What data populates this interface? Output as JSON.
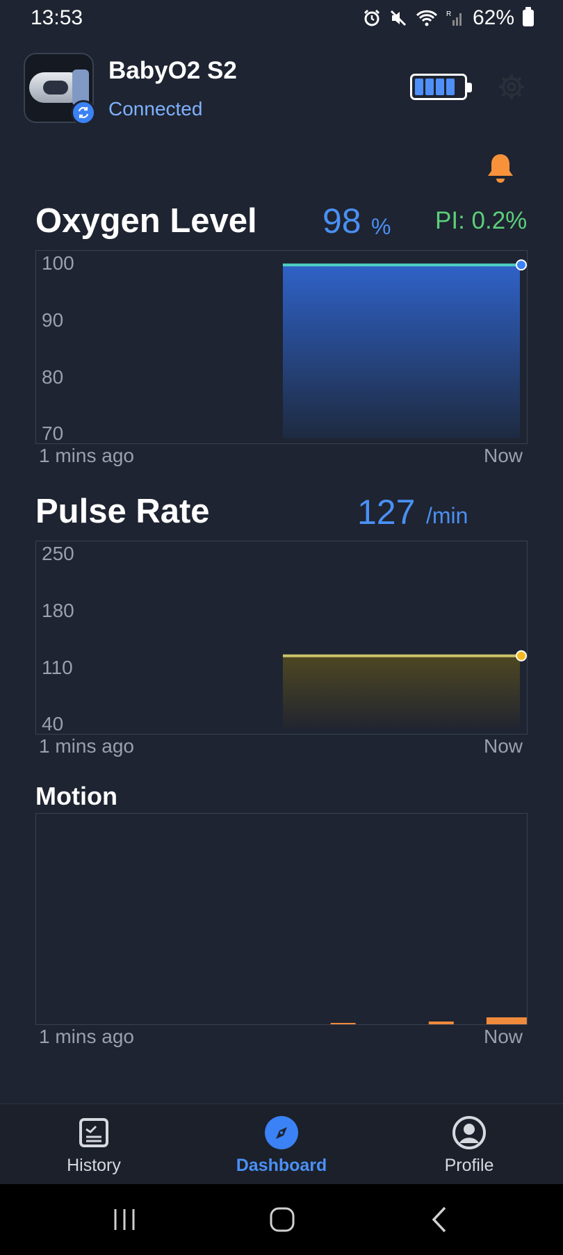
{
  "status_bar": {
    "time": "13:53",
    "battery_text": "62%"
  },
  "device": {
    "name": "BabyO2 S2",
    "connection_status": "Connected",
    "battery_cells": 4
  },
  "oxygen": {
    "title": "Oxygen Level",
    "value": "98",
    "unit": "%",
    "pi": "PI: 0.2%",
    "y_ticks": [
      "100",
      "90",
      "80",
      "70"
    ],
    "x_start": "1 mins ago",
    "x_end": "Now"
  },
  "pulse": {
    "title": "Pulse Rate",
    "value": "127",
    "unit": "/min",
    "y_ticks": [
      "250",
      "180",
      "110",
      "40"
    ],
    "x_start": "1 mins ago",
    "x_end": "Now"
  },
  "motion": {
    "title": "Motion",
    "x_start": "1 mins ago",
    "x_end": "Now"
  },
  "nav": {
    "history": "History",
    "dashboard": "Dashboard",
    "profile": "Profile",
    "active": "dashboard"
  },
  "colors": {
    "background": "#1e2431",
    "accent_blue": "#4a90f4",
    "pi_green": "#5ccf7a",
    "alert_orange": "#f7923a",
    "oxygen_line": "#4fd1c5",
    "pulse_line": "#c9c468",
    "motion_bar": "#f08a3c"
  },
  "chart_data": [
    {
      "type": "area",
      "ylim": [
        70,
        100
      ],
      "yticks": [
        100,
        90,
        80,
        70
      ],
      "x": [
        "1 mins ago",
        "Now"
      ],
      "series": [
        {
          "x_fraction": [
            0.51,
            1.0
          ],
          "values": [
            99.5,
            99.5
          ]
        }
      ]
    },
    {
      "type": "area",
      "ylim": [
        40,
        250
      ],
      "yticks": [
        250,
        180,
        110,
        40
      ],
      "x": [
        "1 mins ago",
        "Now"
      ],
      "series": [
        {
          "x_fraction": [
            0.51,
            1.0
          ],
          "values": [
            127,
            127
          ]
        }
      ]
    },
    {
      "type": "bar",
      "x": [
        "1 mins ago",
        "Now"
      ],
      "series": [
        {
          "x_fraction": [
            0.6,
            0.8,
            0.98
          ],
          "values": [
            0.2,
            0.4,
            1.0
          ]
        }
      ]
    }
  ]
}
